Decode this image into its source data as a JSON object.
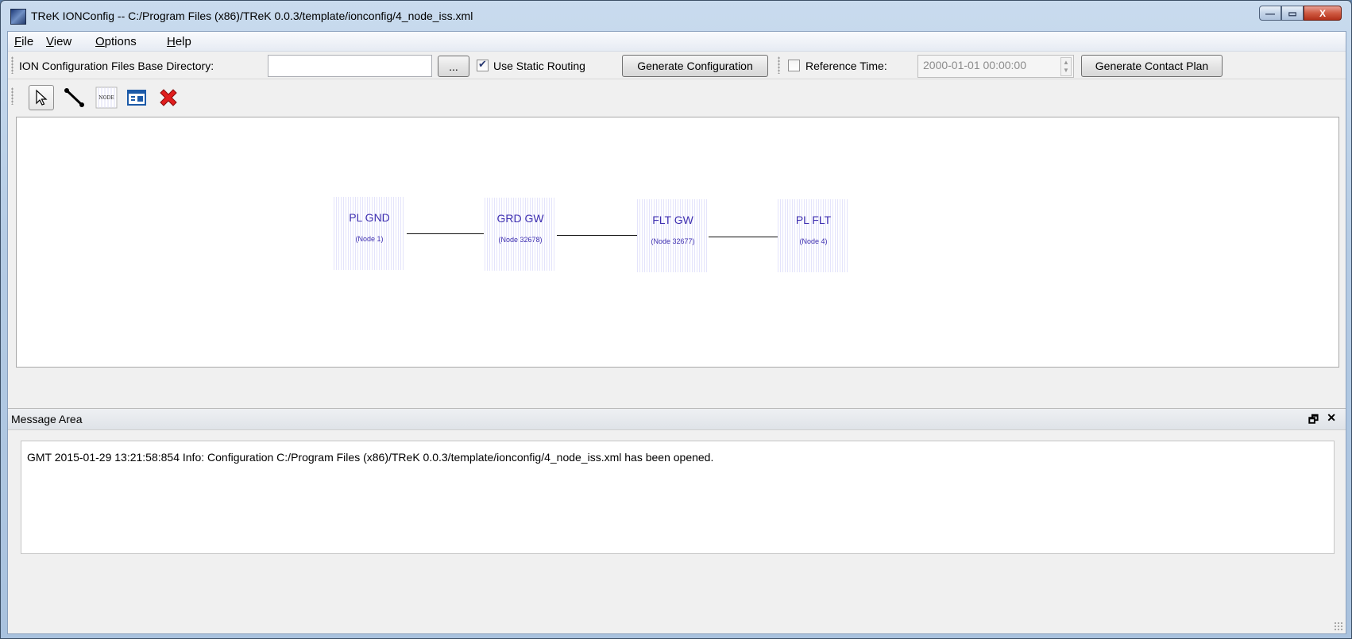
{
  "window": {
    "title": "TReK IONConfig -- C:/Program Files (x86)/TReK 0.0.3/template/ionconfig/4_node_iss.xml",
    "minimize": "—",
    "maximize": "▭",
    "close": "X"
  },
  "menubar": {
    "items": [
      {
        "first": "F",
        "rest": "ile"
      },
      {
        "first": "V",
        "rest": "iew"
      },
      {
        "first": "O",
        "rest": "ptions"
      },
      {
        "first": "H",
        "rest": "elp"
      }
    ]
  },
  "toolbar": {
    "base_dir_label": "ION Configuration Files Base Directory:",
    "base_dir_value": "",
    "browse_label": "...",
    "static_routing_label": "Use Static Routing",
    "static_routing_checked": true,
    "generate_config_label": "Generate Configuration",
    "reference_time_label": "Reference Time:",
    "reference_time_checked": false,
    "reference_time_value": "2000-01-01 00:00:00",
    "generate_contact_plan_label": "Generate Contact Plan"
  },
  "tools": [
    {
      "name": "select-arrow-icon",
      "active": true
    },
    {
      "name": "link-tool-icon",
      "active": false
    },
    {
      "name": "node-tool-icon",
      "label": "NODE",
      "active": false
    },
    {
      "name": "properties-icon",
      "active": false
    },
    {
      "name": "delete-icon",
      "active": false
    }
  ],
  "diagram": {
    "nodes": [
      {
        "name": "PL GND",
        "id": "(Node 1)"
      },
      {
        "name": "GRD GW",
        "id": "(Node 32678)"
      },
      {
        "name": "FLT GW",
        "id": "(Node 32677)"
      },
      {
        "name": "PL FLT",
        "id": "(Node 4)"
      }
    ]
  },
  "message_area": {
    "title": "Message Area",
    "float_icon": "🗗",
    "close_icon": "✕",
    "lines": [
      "GMT 2015-01-29 13:21:58:854  Info:  Configuration C:/Program Files (x86)/TReK 0.0.3/template/ionconfig/4_node_iss.xml has been opened."
    ]
  },
  "colors": {
    "node_text": "#3e2fb0",
    "node_fill": "#e4e4fb",
    "close_button": "#cf5b43",
    "window_frame": "#b4cbe4"
  }
}
